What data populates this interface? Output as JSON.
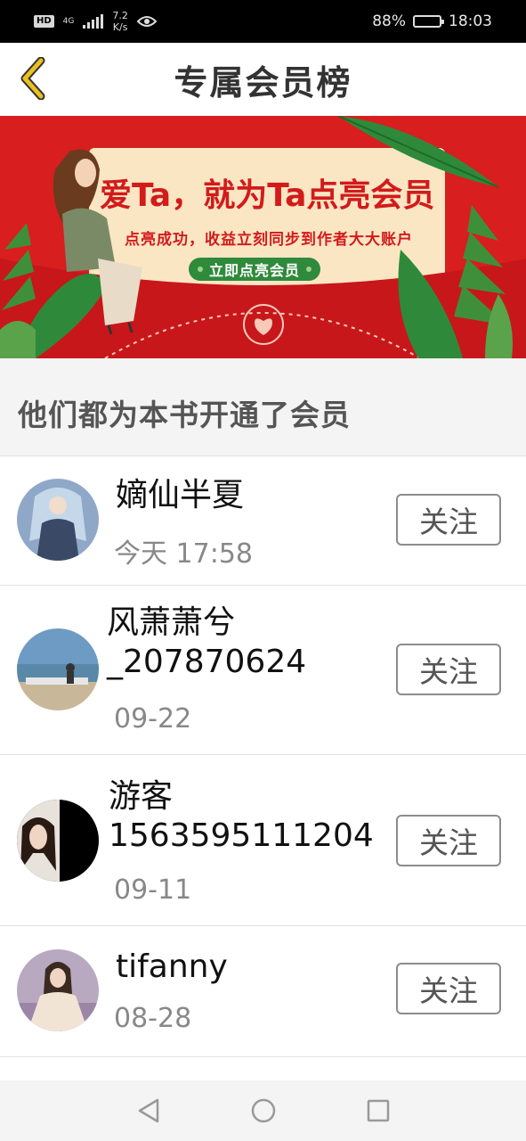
{
  "status_bar": {
    "network_badge": "HD",
    "network_type": "4G",
    "speed_value": "7.2",
    "speed_unit": "K/s",
    "battery_percent": "88%",
    "battery_level": 0.88,
    "time": "18:03"
  },
  "header": {
    "title": "专属会员榜",
    "back_icon": "chevron-left-icon",
    "accent_color": "#e8c020"
  },
  "banner": {
    "headline": "爱Ta，就为Ta点亮会员",
    "subtitle": "点亮成功，收益立刻同步到作者大大账户",
    "cta_label": "立即点亮会员",
    "background_color": "#d81e1e",
    "cta_color": "#2f8a3b"
  },
  "section": {
    "title": "他们都为本书开通了会员"
  },
  "members": [
    {
      "name": "嫡仙半夏",
      "time": "今天 17:58",
      "follow_label": "关注"
    },
    {
      "name": "风萧萧兮\n_207870624",
      "time": "09-22",
      "follow_label": "关注"
    },
    {
      "name": "游客\n1563595111204",
      "time": "09-11",
      "follow_label": "关注"
    },
    {
      "name": "tifanny",
      "time": "08-28",
      "follow_label": "关注"
    }
  ],
  "nav_bar": {
    "back_icon": "triangle-back-icon",
    "home_icon": "circle-home-icon",
    "recents_icon": "square-recents-icon"
  }
}
